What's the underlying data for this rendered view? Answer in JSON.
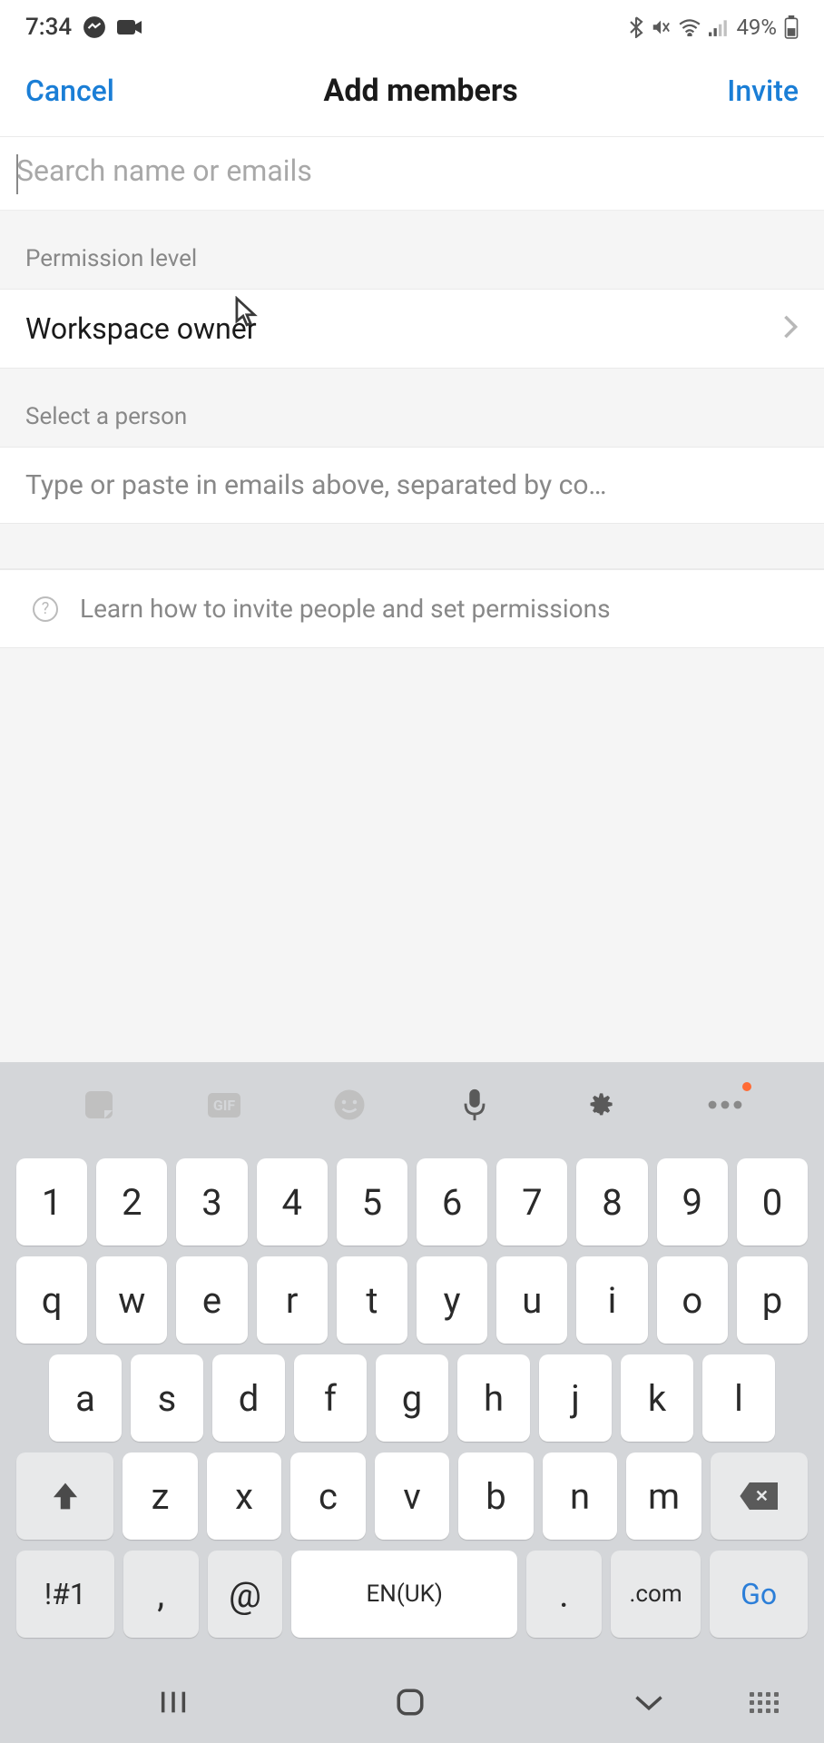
{
  "status": {
    "time": "7:34",
    "battery_pct": "49%"
  },
  "header": {
    "cancel": "Cancel",
    "title": "Add members",
    "invite": "Invite"
  },
  "search": {
    "placeholder": "Search name or emails",
    "value": ""
  },
  "permission": {
    "label": "Permission level",
    "value": "Workspace owner"
  },
  "select_person": {
    "label": "Select a person",
    "hint": "Type or paste in emails above, separated by co…"
  },
  "learn": {
    "text": "Learn how to invite people and set permissions"
  },
  "keyboard": {
    "row1": [
      "1",
      "2",
      "3",
      "4",
      "5",
      "6",
      "7",
      "8",
      "9",
      "0"
    ],
    "row2": [
      "q",
      "w",
      "e",
      "r",
      "t",
      "y",
      "u",
      "i",
      "o",
      "p"
    ],
    "row3": [
      "a",
      "s",
      "d",
      "f",
      "g",
      "h",
      "j",
      "k",
      "l"
    ],
    "row4": [
      "z",
      "x",
      "c",
      "v",
      "b",
      "n",
      "m"
    ],
    "symbols": "!#1",
    "comma": ",",
    "at": "@",
    "space": "EN(UK)",
    "period": ".",
    "dotcom": ".com",
    "go": "Go"
  }
}
